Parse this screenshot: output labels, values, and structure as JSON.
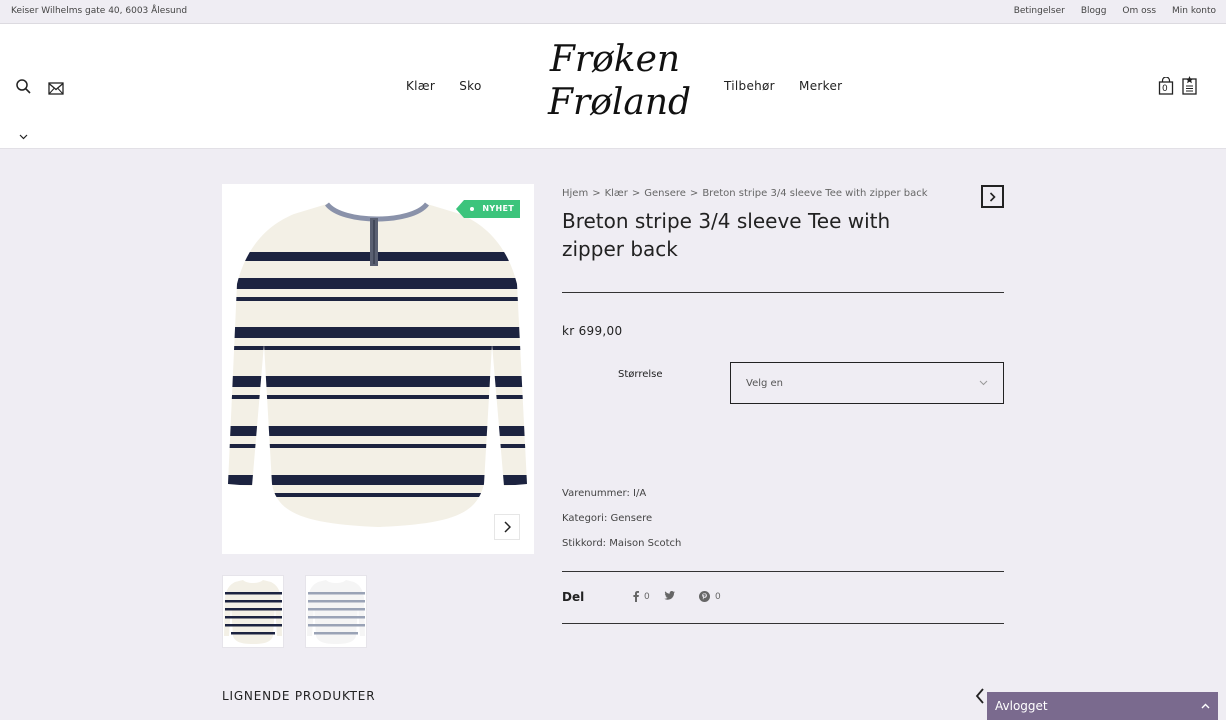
{
  "topbar": {
    "address": "Keiser Wilhelms gate 40, 6003 Ålesund",
    "links": [
      "Betingelser",
      "Blogg",
      "Om oss",
      "Min konto"
    ]
  },
  "header": {
    "logo_line1": "Frøken",
    "logo_line2": "Frøland",
    "nav_left": [
      "Klær",
      "Sko"
    ],
    "nav_right": [
      "Tilbehør",
      "Merker"
    ],
    "cart_count": "0"
  },
  "product": {
    "badge": "NYHET",
    "breadcrumb": [
      "Hjem",
      "Klær",
      "Gensere",
      "Breton stripe 3/4 sleeve Tee with zipper back"
    ],
    "breadcrumb_sep": ">",
    "title": "Breton stripe 3/4 sleeve Tee with zipper back",
    "price": "kr 699,00",
    "size_label": "Størrelse",
    "size_placeholder": "Velg en",
    "sku_label": "Varenummer:",
    "sku_value": "I/A",
    "category_label": "Kategori:",
    "category_value": "Gensere",
    "tags_label": "Stikkord:",
    "tags_value": "Maison Scotch",
    "share_label": "Del",
    "share_facebook_count": "0",
    "share_pinterest_count": "0"
  },
  "related": {
    "title": "LIGNENDE PRODUKTER"
  },
  "status_bar": {
    "label": "Avlogget"
  },
  "colors": {
    "background": "#efedf3",
    "badge": "#3cc47c",
    "status_bar": "#7a6a8e",
    "navy_stripe": "#1c2340"
  }
}
